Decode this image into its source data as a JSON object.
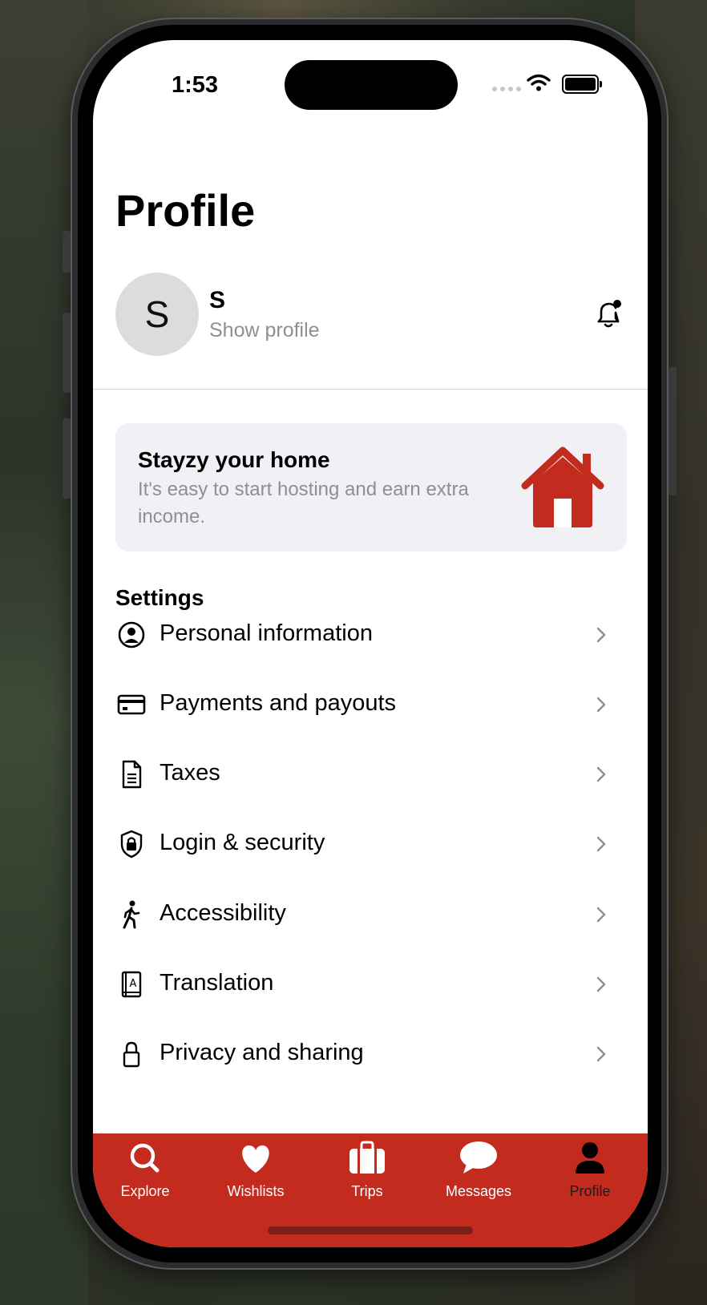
{
  "status_bar": {
    "time": "1:53"
  },
  "header": {
    "title": "Profile"
  },
  "profile": {
    "avatar_initial": "S",
    "name": "S",
    "subtitle": "Show profile"
  },
  "host_card": {
    "title": "Stayzy your home",
    "description": "It's easy to start hosting and earn extra income.",
    "icon": "house-icon"
  },
  "settings": {
    "heading": "Settings",
    "items": [
      {
        "label": "Personal information",
        "icon": "person-circle-icon"
      },
      {
        "label": "Payments and payouts",
        "icon": "credit-card-icon"
      },
      {
        "label": "Taxes",
        "icon": "document-icon"
      },
      {
        "label": "Login & security",
        "icon": "shield-lock-icon"
      },
      {
        "label": "Accessibility",
        "icon": "accessibility-walk-icon"
      },
      {
        "label": "Translation",
        "icon": "translation-book-icon"
      },
      {
        "label": "Privacy and sharing",
        "icon": "lock-icon"
      }
    ]
  },
  "tab_bar": {
    "accent": "#c42b1f",
    "active": "Profile",
    "tabs": [
      {
        "label": "Explore",
        "icon": "search-icon"
      },
      {
        "label": "Wishlists",
        "icon": "heart-icon"
      },
      {
        "label": "Trips",
        "icon": "suitcase-icon"
      },
      {
        "label": "Messages",
        "icon": "chat-bubble-icon"
      },
      {
        "label": "Profile",
        "icon": "person-icon"
      }
    ]
  },
  "colors": {
    "brand_red": "#c42b1f",
    "card_bg": "#f0f0f5",
    "secondary_text": "#8e8e93"
  }
}
